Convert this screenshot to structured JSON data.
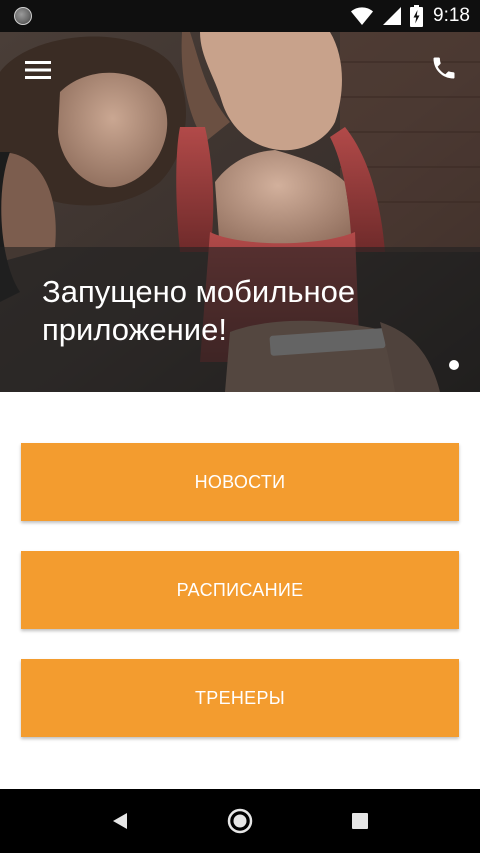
{
  "status_bar": {
    "time": "9:18",
    "icons": [
      "notification-dot-icon",
      "wifi-icon",
      "signal-icon",
      "battery-charging-icon"
    ]
  },
  "hero": {
    "title": "Запущено мобильное приложение!",
    "menu_icon": "hamburger-menu-icon",
    "phone_icon": "phone-icon",
    "slides_indicator": "slide 1 of 1"
  },
  "menu": {
    "items": [
      {
        "label": "НОВОСТИ"
      },
      {
        "label": "РАСПИСАНИЕ"
      },
      {
        "label": "ТРЕНЕРЫ"
      }
    ]
  },
  "nav_bar": {
    "icons": [
      "back-icon",
      "home-icon",
      "recents-icon"
    ]
  },
  "colors": {
    "accent": "#f39c2f",
    "status_bar": "#0f0f0f",
    "nav_bar": "#000000",
    "caption_overlay": "#222222"
  }
}
